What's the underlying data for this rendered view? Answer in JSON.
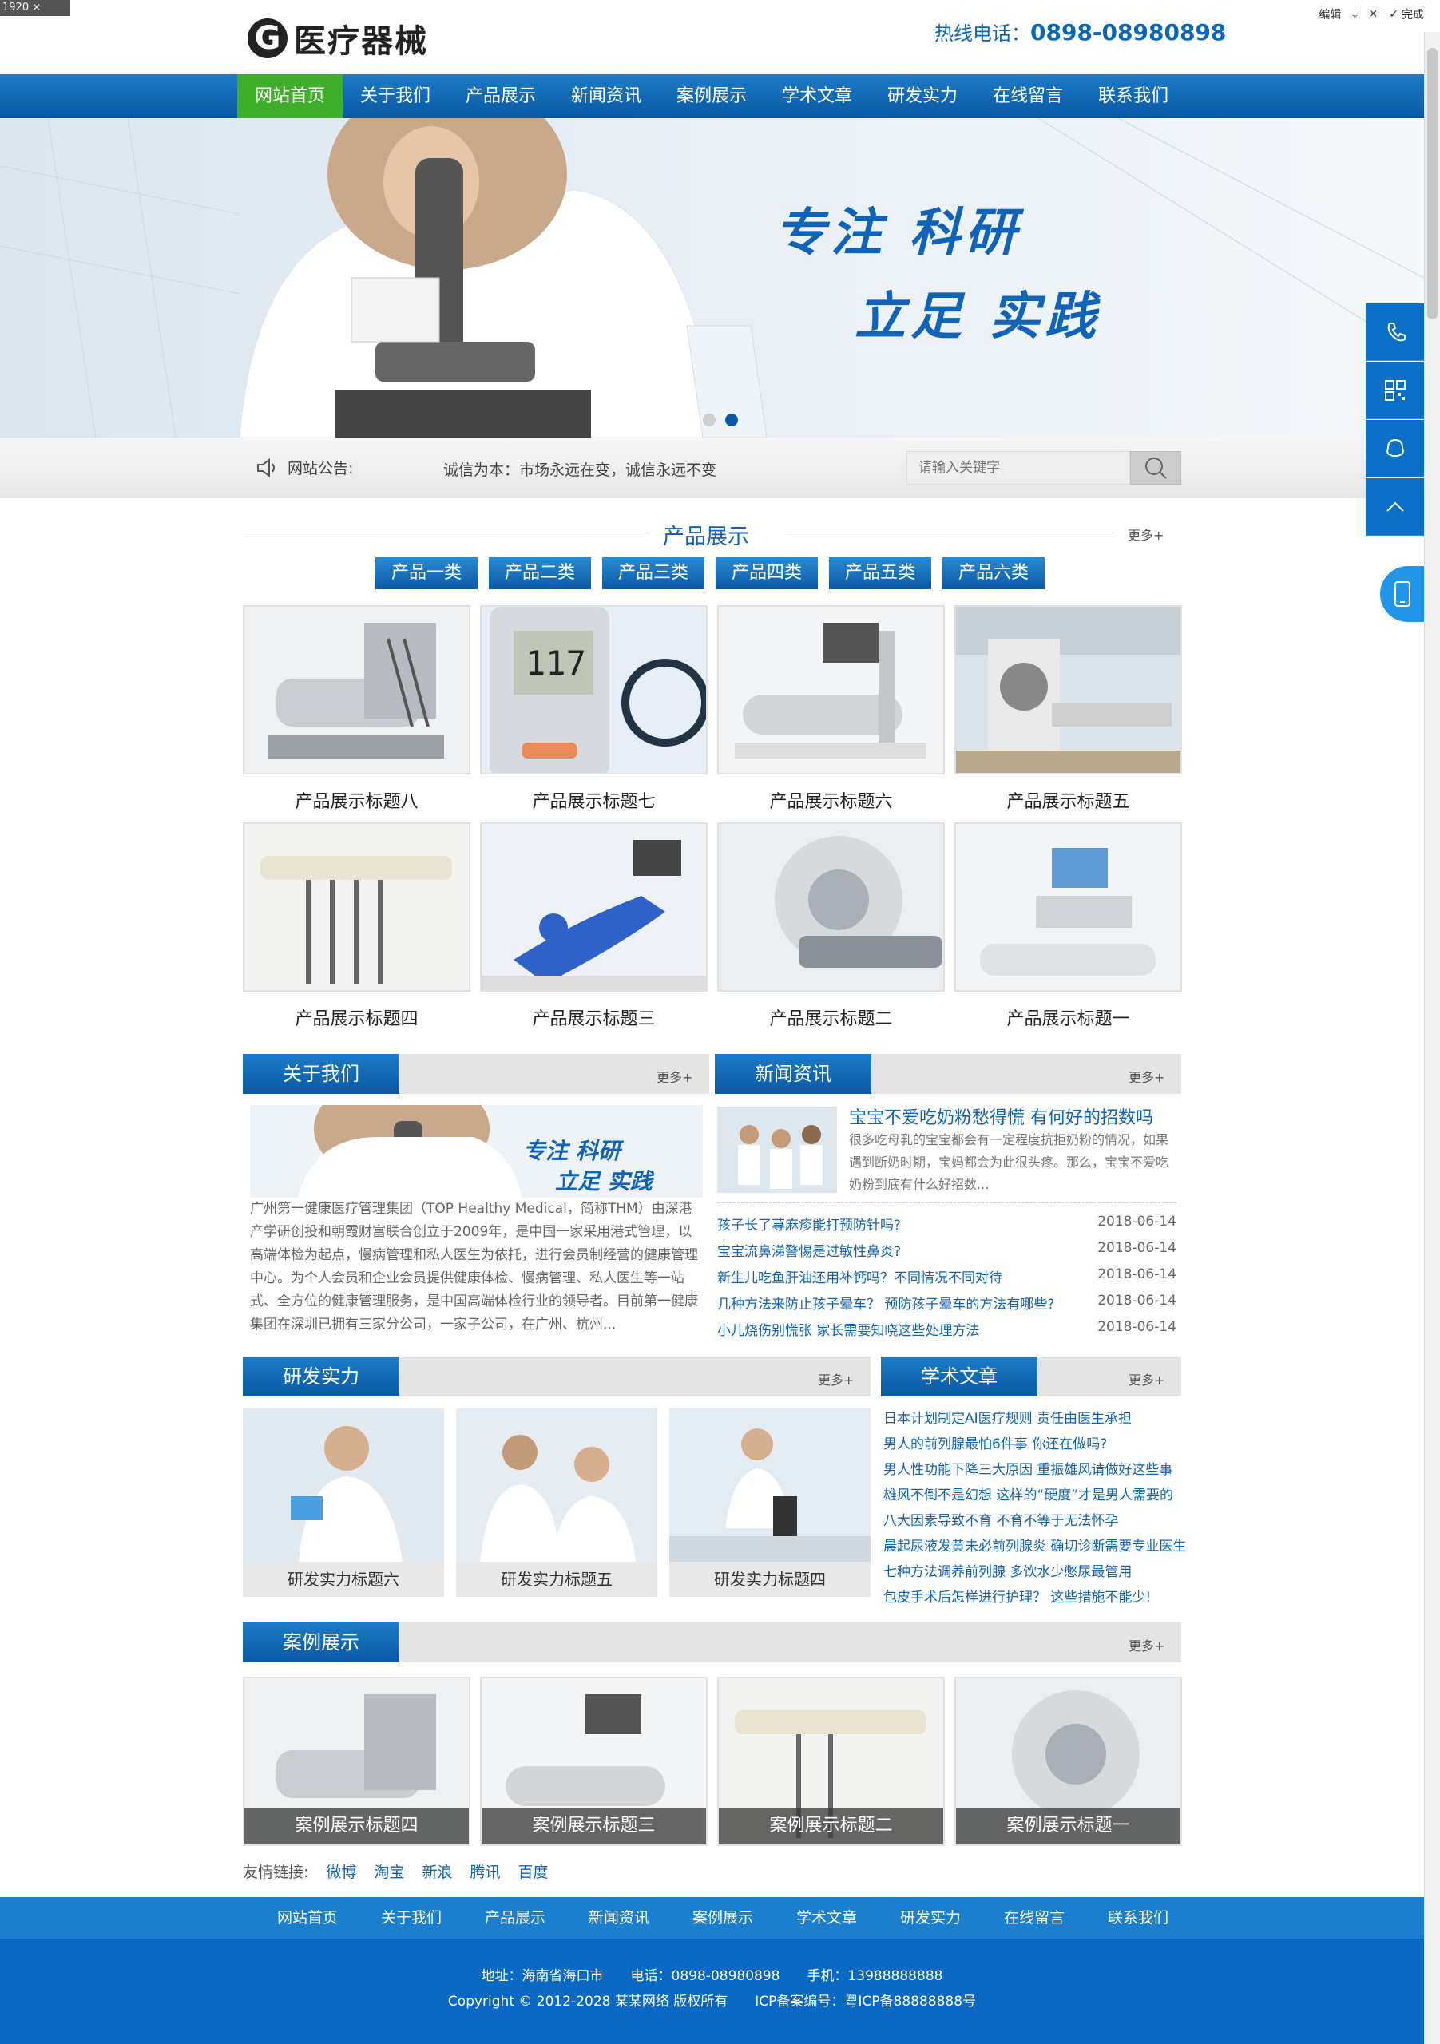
{
  "dim_tag": "1920 × 1080",
  "toolbar": {
    "edit": "编辑",
    "done": "完成"
  },
  "header": {
    "logo_mark": "G",
    "logo_text": "医疗器械",
    "hotline_label": "热线电话：",
    "hotline_number": "0898-08980898"
  },
  "nav": {
    "items": [
      "网站首页",
      "关于我们",
      "产品展示",
      "新闻资讯",
      "案例展示",
      "学术文章",
      "研发实力",
      "在线留言",
      "联系我们"
    ]
  },
  "banner": {
    "slogan_line1": "专注 科研",
    "slogan_line2": "立足 实践"
  },
  "notice": {
    "label": "网站公告:",
    "text": "诚信为本：市场永远在变，诚信永远不变"
  },
  "search": {
    "placeholder": "请输入关键字"
  },
  "products": {
    "title": "产品展示",
    "more": "更多+",
    "categories": [
      "产品一类",
      "产品二类",
      "产品三类",
      "产品四类",
      "产品五类",
      "产品六类"
    ],
    "items": [
      "产品展示标题八",
      "产品展示标题七",
      "产品展示标题六",
      "产品展示标题五",
      "产品展示标题四",
      "产品展示标题三",
      "产品展示标题二",
      "产品展示标题一"
    ]
  },
  "about": {
    "title": "关于我们",
    "more": "更多+",
    "img_slogan1": "专注 科研",
    "img_slogan2": "立足 实践",
    "text": "广州第一健康医疗管理集团（TOP Healthy Medical，简称THM）由深港产学研创投和朝霞财富联合创立于2009年，是中国一家采用港式管理，以高端体检为起点，慢病管理和私人医生为依托，进行会员制经营的健康管理中心。为个人会员和企业会员提供健康体检、慢病管理、私人医生等一站式、全方位的健康管理服务，是中国高端体检行业的领导者。目前第一健康集团在深圳已拥有三家分公司，一家子公司，在广州、杭州..."
  },
  "news": {
    "title": "新闻资讯",
    "more": "更多+",
    "top_title": "宝宝不爱吃奶粉愁得慌 有何好的招数吗",
    "top_text": "很多吃母乳的宝宝都会有一定程度抗拒奶粉的情况，如果遇到断奶时期，宝妈都会为此很头疼。那么，宝宝不爱吃奶粉到底有什么好招数...",
    "list": [
      {
        "title": "孩子长了荨麻疹能打预防针吗?",
        "date": "2018-06-14"
      },
      {
        "title": "宝宝流鼻涕警惕是过敏性鼻炎?",
        "date": "2018-06-14"
      },
      {
        "title": "新生儿吃鱼肝油还用补钙吗？不同情况不同对待",
        "date": "2018-06-14"
      },
      {
        "title": "几种方法来防止孩子晕车？ 预防孩子晕车的方法有哪些?",
        "date": "2018-06-14"
      },
      {
        "title": "小儿烧伤别慌张 家长需要知晓这些处理方法",
        "date": "2018-06-14"
      }
    ]
  },
  "rd": {
    "title": "研发实力",
    "more": "更多+",
    "items": [
      "研发实力标题六",
      "研发实力标题五",
      "研发实力标题四"
    ]
  },
  "articles": {
    "title": "学术文章",
    "more": "更多+",
    "items": [
      "日本计划制定AI医疗规则 责任由医生承担",
      "男人的前列腺最怕6件事 你还在做吗?",
      "男人性功能下降三大原因 重振雄风请做好这些事",
      "雄风不倒不是幻想 这样的“硬度”才是男人需要的",
      "八大因素导致不育 不育不等于无法怀孕",
      "晨起尿液发黄未必前列腺炎 确切诊断需要专业医生",
      "七种方法调养前列腺 多饮水少憋尿最管用",
      "包皮手术后怎样进行护理？ 这些措施不能少!"
    ]
  },
  "cases": {
    "title": "案例展示",
    "more": "更多+",
    "items": [
      "案例展示标题四",
      "案例展示标题三",
      "案例展示标题二",
      "案例展示标题一"
    ]
  },
  "links": {
    "label": "友情链接:",
    "items": [
      "微博",
      "淘宝",
      "新浪",
      "腾讯",
      "百度"
    ]
  },
  "footer_nav": {
    "items": [
      "网站首页",
      "关于我们",
      "产品展示",
      "新闻资讯",
      "案例展示",
      "学术文章",
      "研发实力",
      "在线留言",
      "联系我们"
    ]
  },
  "footer": {
    "address": "地址：海南省海口市　　电话：0898-08980898　　手机：13988888888",
    "copyright": "Copyright © 2012-2028 某某网络 版权所有　　ICP备案编号：粤ICP备88888888号"
  },
  "colors": {
    "brand_blue": "#0a58a3",
    "active_green": "#3fae2a",
    "footer_blue": "#0a69c4"
  }
}
